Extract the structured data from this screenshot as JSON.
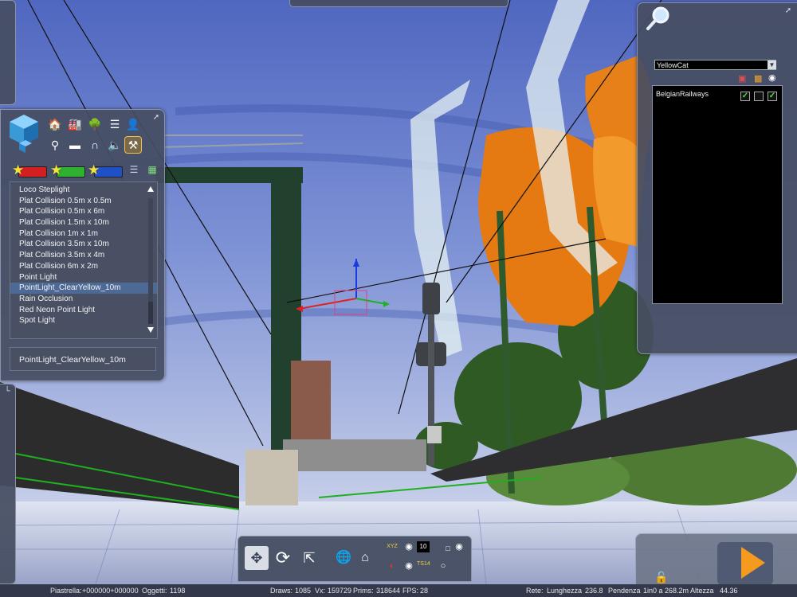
{
  "object_panel": {
    "toolbar_icons": [
      "house-icon",
      "factory-icon",
      "tree-icon",
      "track-icon",
      "person-icon",
      "signal-icon",
      "bridge-icon",
      "tunnel-icon",
      "speaker-icon",
      "crane-icon"
    ],
    "category_bars": [
      {
        "color": "#d22020",
        "icon": "star-icon"
      },
      {
        "color": "#30b030",
        "icon": "star-icon"
      },
      {
        "color": "#2050c8",
        "icon": "star-icon"
      }
    ],
    "view_icons": [
      "list-view-icon",
      "grid-view-icon"
    ],
    "items": [
      "Loco Steplight",
      "Plat Collision 0.5m x 0.5m",
      "Plat Collision 0.5m x 6m",
      "Plat Collision 1.5m x 10m",
      "Plat Collision 1m x 1m",
      "Plat Collision 3.5m x 10m",
      "Plat Collision 3.5m x 4m",
      "Plat Collision 6m x 2m",
      "Point Light",
      "PointLight_ClearYellow_10m",
      "Rain Occlusion",
      "Red Neon Point Light",
      "Spot Light"
    ],
    "selected_index": 9,
    "selected_name": "PointLight_ClearYellow_10m"
  },
  "layer_panel": {
    "region_filter": "YellowCat",
    "header_icons": [
      "train-filter-icon",
      "loco-filter-icon",
      "eye-icon"
    ],
    "layers": [
      {
        "name": "BelgianRailways",
        "check1": true,
        "check2": false,
        "check3": true
      }
    ]
  },
  "bottom_toolbar": {
    "buttons": [
      "move-icon",
      "rotate-icon",
      "scale-icon",
      "globe-icon",
      "home-icon"
    ],
    "counter_value": "10",
    "small_label_1": "TS14",
    "small_label_2": "XYZ"
  },
  "status_bar": {
    "tile_label": "Piastrella:",
    "tile_value": "+000000+000000",
    "objects_label": "Oggetti:",
    "objects_value": "1198",
    "draws_label": "Draws:",
    "draws_value": "1085",
    "vx_label": "Vx:",
    "vx_value": "159729",
    "prims_label": "Prims:",
    "prims_value": "318644",
    "fps_label": "FPS:",
    "fps_value": "28",
    "network_label": "Rete:",
    "length_label": "Lunghezza",
    "length_value": "236.8",
    "slope_label": "Pendenza",
    "slope_value": "1in0 a 268.2m",
    "height_label": "Altezza",
    "height_value": "44.36"
  },
  "colors": {
    "panel": "#464e62",
    "selection": "#4d6a96",
    "play_accent": "#f39a1f",
    "check_green": "#4ee04e"
  }
}
